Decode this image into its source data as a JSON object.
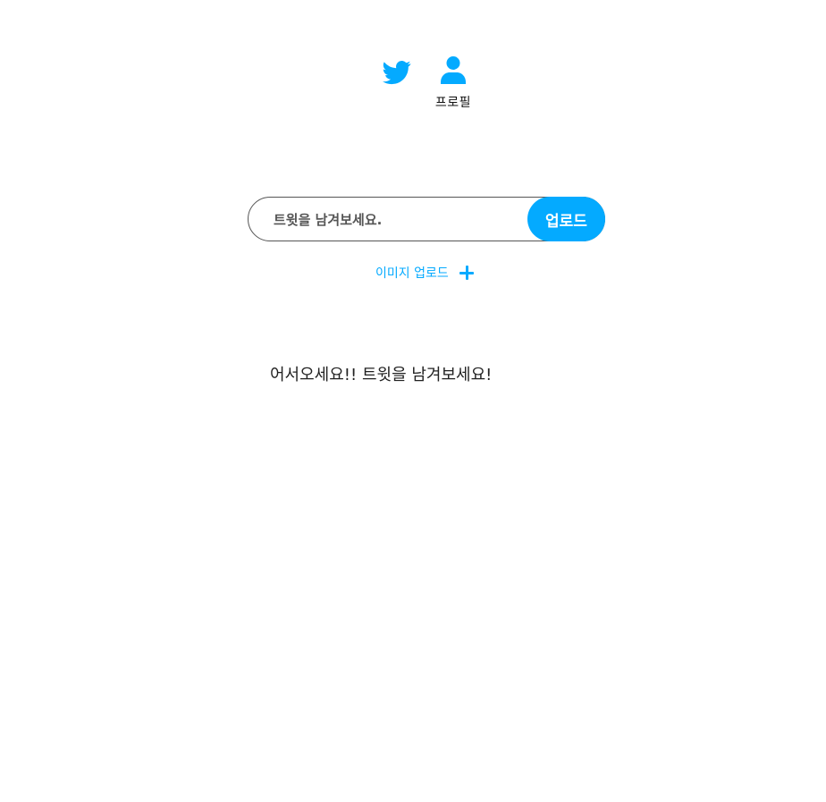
{
  "nav": {
    "home_icon": "twitter-bird-icon",
    "profile_icon": "user-icon",
    "profile_label": "프로필"
  },
  "form": {
    "placeholder": "트윗을 남겨보세요.",
    "value": "",
    "submit_label": "업로드"
  },
  "image_upload": {
    "label": "이미지 업로드",
    "icon": "plus-icon"
  },
  "feed": {
    "empty_message": "어서오세요!! 트윗을 남겨보세요!"
  },
  "colors": {
    "accent": "#04aaff",
    "text": "#222222",
    "border": "#555555"
  }
}
